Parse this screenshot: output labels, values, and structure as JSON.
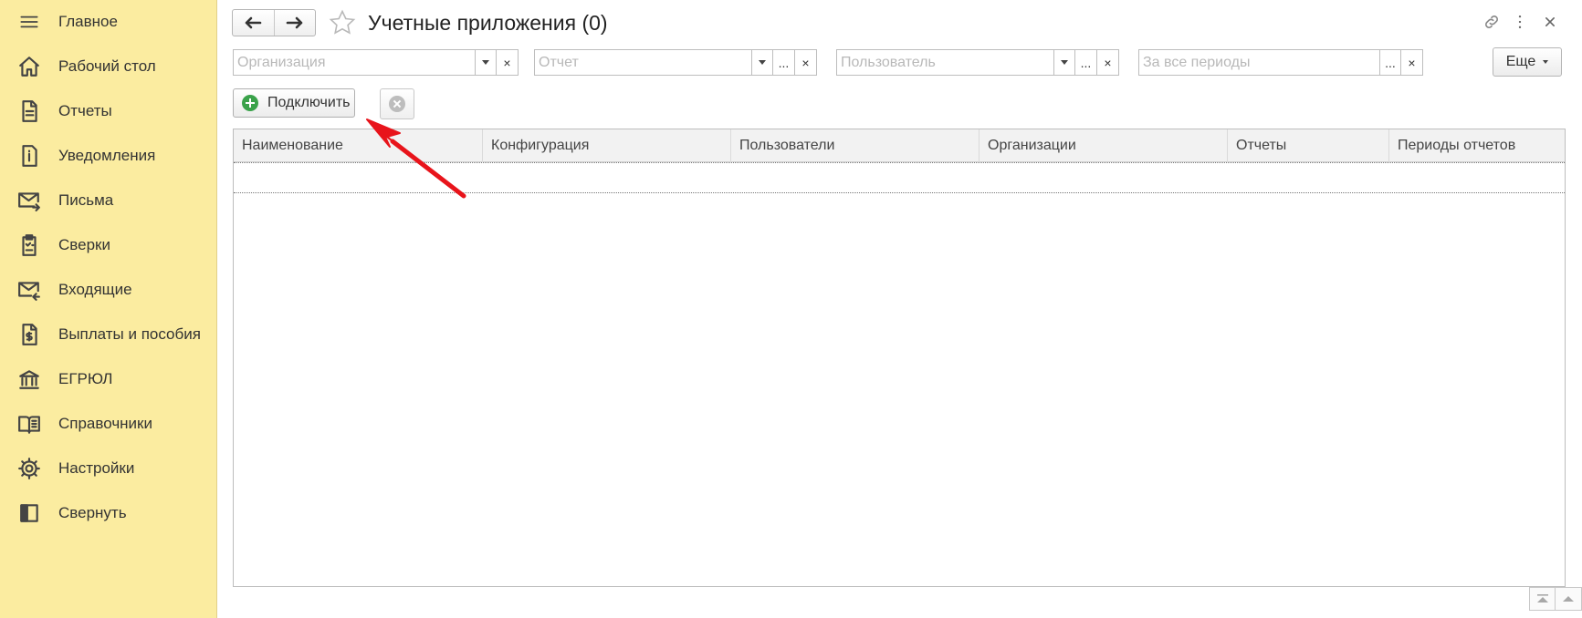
{
  "sidebar": {
    "items": [
      {
        "label": "Главное",
        "icon": "menu-icon"
      },
      {
        "label": "Рабочий стол",
        "icon": "home-icon"
      },
      {
        "label": "Отчеты",
        "icon": "document-icon"
      },
      {
        "label": "Уведомления",
        "icon": "info-icon"
      },
      {
        "label": "Письма",
        "icon": "mail-out-icon"
      },
      {
        "label": "Сверки",
        "icon": "checklist-icon"
      },
      {
        "label": "Входящие",
        "icon": "mail-in-icon"
      },
      {
        "label": "Выплаты и пособия",
        "icon": "payment-doc-icon"
      },
      {
        "label": "ЕГРЮЛ",
        "icon": "bank-icon"
      },
      {
        "label": "Справочники",
        "icon": "book-icon"
      },
      {
        "label": "Настройки",
        "icon": "gear-icon"
      },
      {
        "label": "Свернуть",
        "icon": "collapse-icon"
      }
    ]
  },
  "header": {
    "title": "Учетные приложения (0)"
  },
  "filters": {
    "organization_placeholder": "Организация",
    "report_placeholder": "Отчет",
    "user_placeholder": "Пользователь",
    "period_placeholder": "За все периоды",
    "select_label": "...",
    "clear_label": "×"
  },
  "toolbar": {
    "more_label": "Еще",
    "connect_label": "Подключить"
  },
  "table": {
    "columns": [
      "Наименование",
      "Конфигурация",
      "Пользователи",
      "Организации",
      "Отчеты",
      "Периоды отчетов"
    ]
  },
  "colors": {
    "sidebar_bg": "#fbeca0",
    "accent_green": "#3aa24a",
    "annotation_arrow": "#e8141b"
  }
}
